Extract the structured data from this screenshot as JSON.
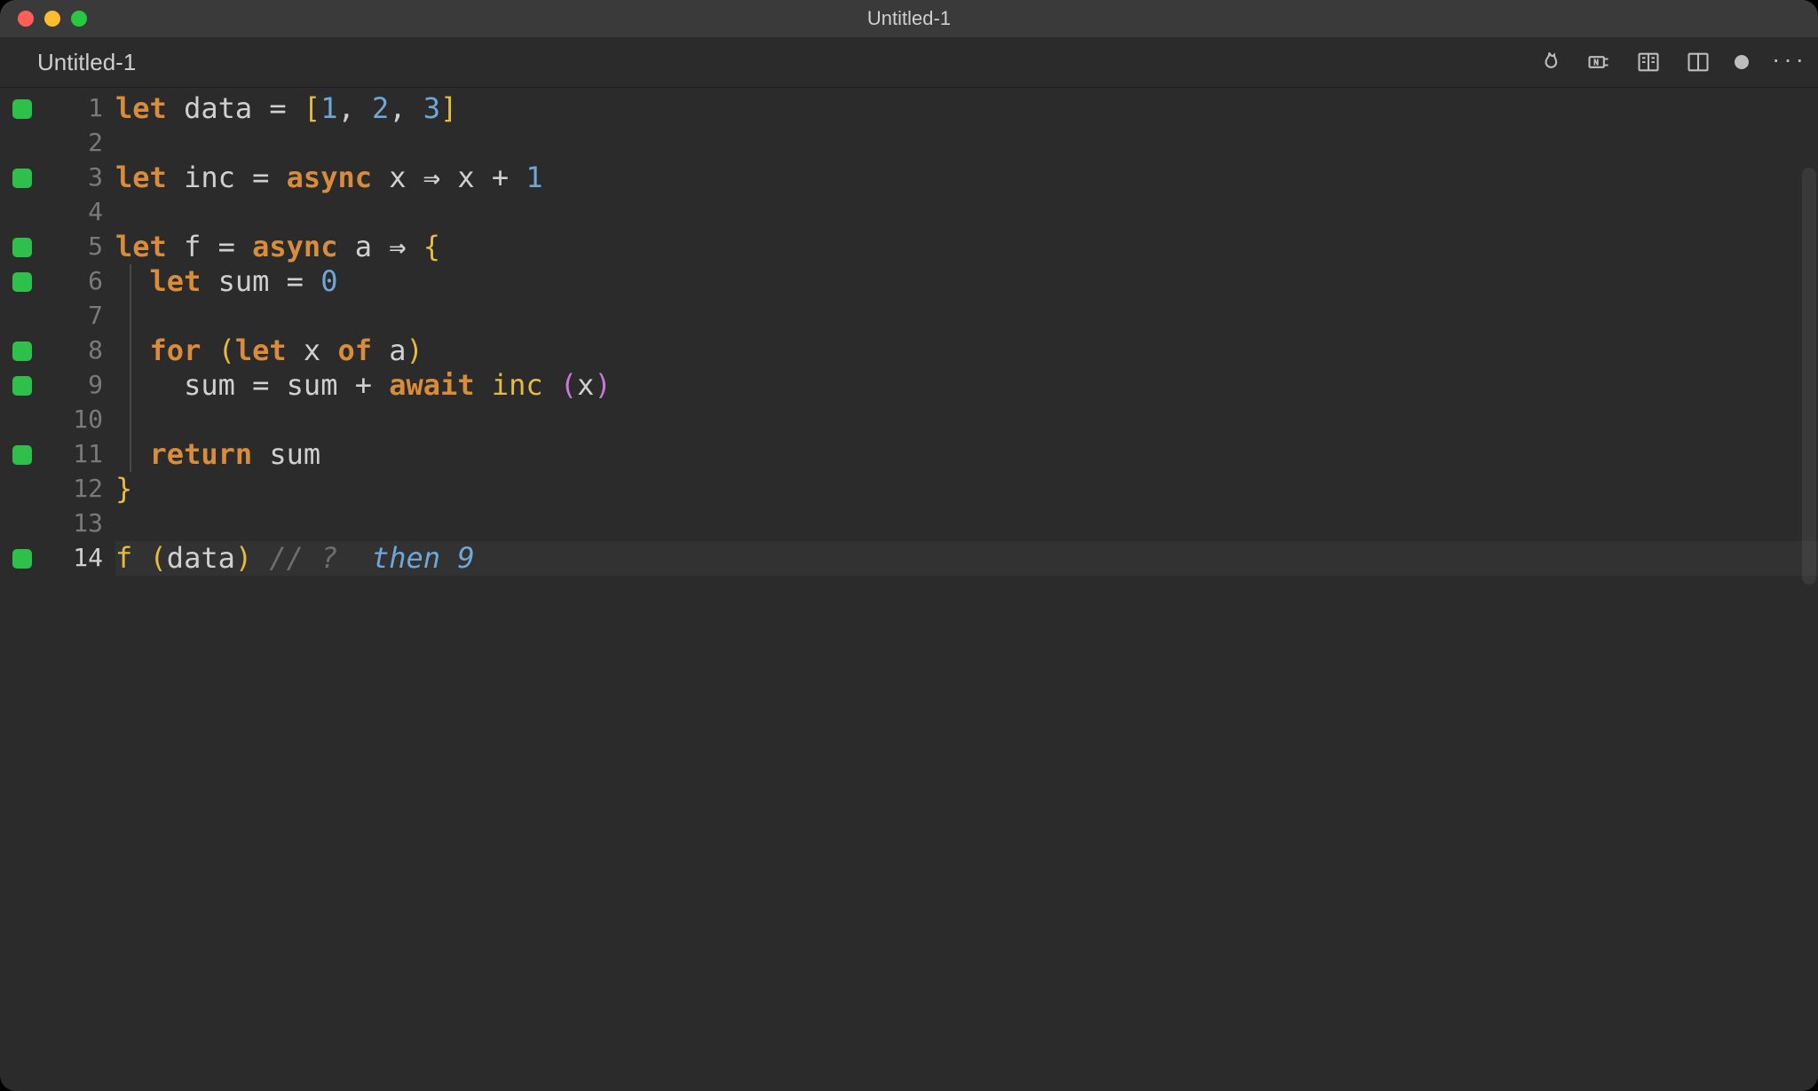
{
  "window": {
    "title": "Untitled-1"
  },
  "tab": {
    "label": "Untitled-1"
  },
  "toolbar": {
    "icons": {
      "flame": "flame-icon",
      "case_sens": "case-sensitive-icon",
      "book": "book-icon",
      "split": "split-icon",
      "modified": "modified-icon",
      "more": "more-icon"
    }
  },
  "colors": {
    "background": "#2b2b2b",
    "titlebar": "#3a3a3a",
    "keyword": "#d98c3a",
    "number": "#6fa8d8",
    "brace": "#e7bb3f",
    "paren_magenta": "#c678dd",
    "comment": "#6e6e6e",
    "marker": "#2fbf4b"
  },
  "editor": {
    "current_line": 14,
    "lines": [
      {
        "n": 1,
        "marker": true
      },
      {
        "n": 2,
        "marker": false
      },
      {
        "n": 3,
        "marker": true
      },
      {
        "n": 4,
        "marker": false
      },
      {
        "n": 5,
        "marker": true
      },
      {
        "n": 6,
        "marker": true
      },
      {
        "n": 7,
        "marker": false
      },
      {
        "n": 8,
        "marker": true
      },
      {
        "n": 9,
        "marker": true
      },
      {
        "n": 10,
        "marker": false
      },
      {
        "n": 11,
        "marker": true
      },
      {
        "n": 12,
        "marker": false
      },
      {
        "n": 13,
        "marker": false
      },
      {
        "n": 14,
        "marker": true
      }
    ],
    "tokens": {
      "l1": {
        "let": "let",
        "sp": " ",
        "data": "data",
        "eq": " = ",
        "lb": "[",
        "n1": "1",
        "c": ", ",
        "n2": "2",
        "n3": "3",
        "rb": "]"
      },
      "l3": {
        "let": "let",
        "inc": "inc",
        "eq": " = ",
        "async": "async",
        "x": " x ",
        "arrow": "⇒",
        "xp": " x + ",
        "one": "1"
      },
      "l5": {
        "let": "let",
        "f": "f",
        "eq": " = ",
        "async": "async",
        "a": " a ",
        "arrow": "⇒",
        "sp": " ",
        "lb": "{"
      },
      "l6": {
        "pad": "  ",
        "let": "let",
        "sum": " sum",
        "eq": " = ",
        "zero": "0"
      },
      "l8": {
        "pad": "  ",
        "for": "for",
        "sp": " ",
        "lp": "(",
        "let": "let",
        "x": " x ",
        "of": "of",
        "a": " a",
        "rp": ")"
      },
      "l9": {
        "pad": "    ",
        "sum": "sum",
        "eq": " = ",
        "sum2": "sum",
        "plus": " + ",
        "await": "await",
        "sp": " ",
        "inc": "inc",
        "sp2": " ",
        "lp": "(",
        "x": "x",
        "rp": ")"
      },
      "l11": {
        "pad": "  ",
        "return": "return",
        "sum": " sum"
      },
      "l12": {
        "rb": "}"
      },
      "l14": {
        "f": "f",
        "sp": " ",
        "lp": "(",
        "data": "data",
        "rp": ")",
        "sp2": " ",
        "cm": "// ?  ",
        "then": "then ",
        "nine": "9"
      }
    }
  }
}
